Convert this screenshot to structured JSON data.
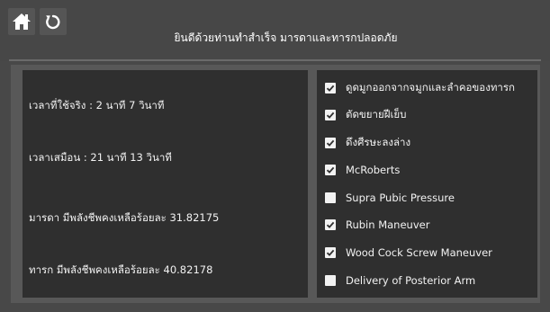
{
  "header": {
    "title": "ยินดีด้วยท่านทำสำเร็จ มารดาและทารกปลอดภัย",
    "home_icon": "home-icon",
    "restart_icon": "restart-icon"
  },
  "stats": [
    {
      "text": "เวลาที่ใช้จริง : 2 นาที 7 วินาที"
    },
    {
      "text": "เวลาเสมือน : 21 นาที 13 วินาที"
    },
    {
      "text": "มารดา มีพลังชีพคงเหลือร้อยละ 31.82175"
    },
    {
      "text": "ทารก มีพลังชีพคงเหลือร้อยละ 40.82178"
    }
  ],
  "checklist": [
    {
      "label": "ดูดมูกออกจากจมูกและลำคอของทารก",
      "checked": true
    },
    {
      "label": "ตัดขยายฝีเย็บ",
      "checked": true
    },
    {
      "label": "ดึงศีรษะลงล่าง",
      "checked": true
    },
    {
      "label": "McRoberts",
      "checked": true
    },
    {
      "label": "Supra Pubic Pressure",
      "checked": false
    },
    {
      "label": "Rubin Maneuver",
      "checked": true
    },
    {
      "label": "Wood Cock Screw Maneuver",
      "checked": true
    },
    {
      "label": "Delivery of Posterior Arm",
      "checked": false
    }
  ],
  "colors": {
    "background": "#484848",
    "panel": "#2f2f2f",
    "text": "#f2f2f2"
  }
}
